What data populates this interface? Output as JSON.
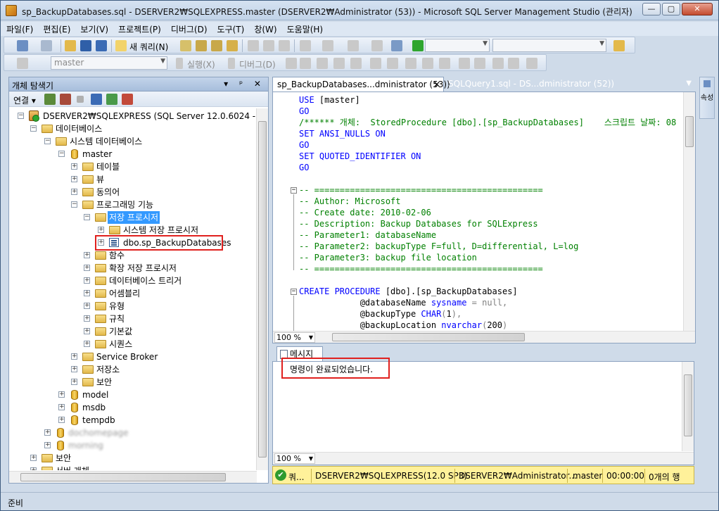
{
  "window": {
    "title": "sp_BackupDatabases.sql - DSERVER2₩SQLEXPRESS.master (DSERVER2₩Administrator (53)) - Microsoft SQL Server Management Studio (관리자)",
    "minimize": "—",
    "maximize": "▢",
    "close": "✕"
  },
  "menu": [
    "파일(F)",
    "편집(E)",
    "보기(V)",
    "프로젝트(P)",
    "디버그(D)",
    "도구(T)",
    "창(W)",
    "도움말(H)"
  ],
  "toolbar1": {
    "new_query": "새 쿼리(N)"
  },
  "toolbar2": {
    "database": "master",
    "execute": "실행(X)",
    "debug": "디버그(D)"
  },
  "object_explorer": {
    "title": "개체 탐색기",
    "header_buttons": "▾ ᵖ ✕",
    "connect": "연결 ▾",
    "tree": [
      {
        "label": "DSERVER2₩SQLEXPRESS (SQL Server 12.0.6024 - DSER",
        "expander": "−"
      },
      {
        "label": "데이터베이스",
        "expander": "−"
      },
      {
        "label": "시스템 데이터베이스",
        "expander": "−"
      },
      {
        "label": "master",
        "expander": "−"
      },
      {
        "label": "테이블",
        "expander": "+"
      },
      {
        "label": "뷰",
        "expander": "+"
      },
      {
        "label": "동의어",
        "expander": "+"
      },
      {
        "label": "프로그래밍 기능",
        "expander": "−"
      },
      {
        "label": "저장 프로시저",
        "expander": "−"
      },
      {
        "label": "시스템 저장 프로시저",
        "expander": "+"
      },
      {
        "label": "dbo.sp_BackupDatabases",
        "expander": "+"
      },
      {
        "label": "함수",
        "expander": "+"
      },
      {
        "label": "확장 저장 프로시저",
        "expander": "+"
      },
      {
        "label": "데이터베이스 트리거",
        "expander": "+"
      },
      {
        "label": "어셈블리",
        "expander": "+"
      },
      {
        "label": "유형",
        "expander": "+"
      },
      {
        "label": "규칙",
        "expander": "+"
      },
      {
        "label": "기본값",
        "expander": "+"
      },
      {
        "label": "시퀀스",
        "expander": "+"
      },
      {
        "label": "Service Broker",
        "expander": "+"
      },
      {
        "label": "저장소",
        "expander": "+"
      },
      {
        "label": "보안",
        "expander": "+"
      },
      {
        "label": "model",
        "expander": "+"
      },
      {
        "label": "msdb",
        "expander": "+"
      },
      {
        "label": "tempdb",
        "expander": "+"
      },
      {
        "label": "dochomepage",
        "expander": "+"
      },
      {
        "label": "morning",
        "expander": "+"
      },
      {
        "label": "보안",
        "expander": "+"
      },
      {
        "label": "서버 개체",
        "expander": "+"
      }
    ]
  },
  "tabs": [
    {
      "label": "sp_BackupDatabases...dministrator (53))",
      "close": "✕"
    },
    {
      "label": "SQLQuery1.sql - DS...dministrator (52))"
    }
  ],
  "editor": {
    "zoom": "100 %",
    "lines": [
      "USE [master]",
      "GO",
      "/****** 개체:  StoredProcedure [dbo].[sp_BackupDatabases]    스크립트 날짜: 08",
      "SET ANSI_NULLS ON",
      "GO",
      "SET QUOTED_IDENTIFIER ON",
      "GO",
      "",
      "-- =============================================",
      "-- Author: Microsoft",
      "-- Create date: 2010-02-06",
      "-- Description: Backup Databases for SQLExpress",
      "-- Parameter1: databaseName",
      "-- Parameter2: backupType F=full, D=differential, L=log",
      "-- Parameter3: backup file location",
      "-- =============================================",
      "",
      "CREATE PROCEDURE [dbo].[sp_BackupDatabases]",
      "            @databaseName sysname = null,",
      "            @backupType CHAR(1),",
      "            @backupLocation nvarchar(200)"
    ]
  },
  "messages": {
    "tab_label": "메시지",
    "text": "명령이 완료되었습니다.",
    "zoom": "100 %"
  },
  "query_status": {
    "state": "쿼...",
    "server": "DSERVER2₩SQLEXPRESS(12.0 SP3)",
    "user": "DSERVER2₩Administrator...",
    "database": "master",
    "elapsed": "00:00:00",
    "rows": "0개의 행"
  },
  "side_strip": "속성",
  "status_bar": "준비",
  "colors": {
    "selection": "#3399ff",
    "highlight_box": "#e0201e",
    "status_bg": "#fff19a"
  }
}
